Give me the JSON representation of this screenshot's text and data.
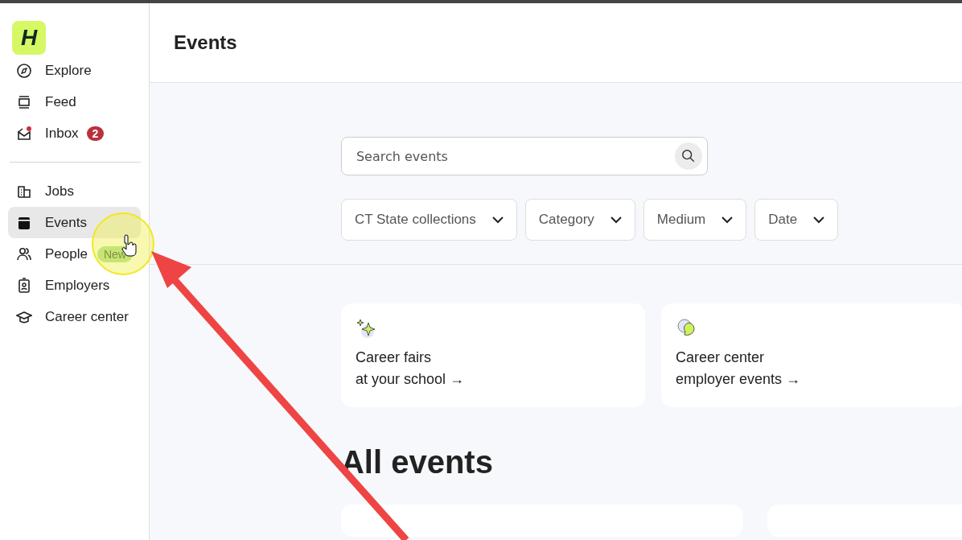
{
  "logo": {
    "letter": "H"
  },
  "nav_primary": [
    {
      "label": "Explore",
      "selected": false
    },
    {
      "label": "Feed",
      "selected": false
    },
    {
      "label": "Inbox",
      "selected": false,
      "badge": "2"
    }
  ],
  "nav_secondary": [
    {
      "label": "Jobs",
      "selected": false
    },
    {
      "label": "Events",
      "selected": true
    },
    {
      "label": "People",
      "selected": false,
      "tag": "New"
    },
    {
      "label": "Employers",
      "selected": false
    },
    {
      "label": "Career center",
      "selected": false
    }
  ],
  "header": {
    "title": "Events"
  },
  "search": {
    "placeholder": "Search events"
  },
  "filters": [
    "CT State collections",
    "Category",
    "Medium",
    "Date"
  ],
  "cards": [
    {
      "line1": "Career fairs",
      "line2": "at your school →"
    },
    {
      "line1": "Career center",
      "line2": "employer events →"
    }
  ],
  "section": {
    "title": "All events"
  }
}
